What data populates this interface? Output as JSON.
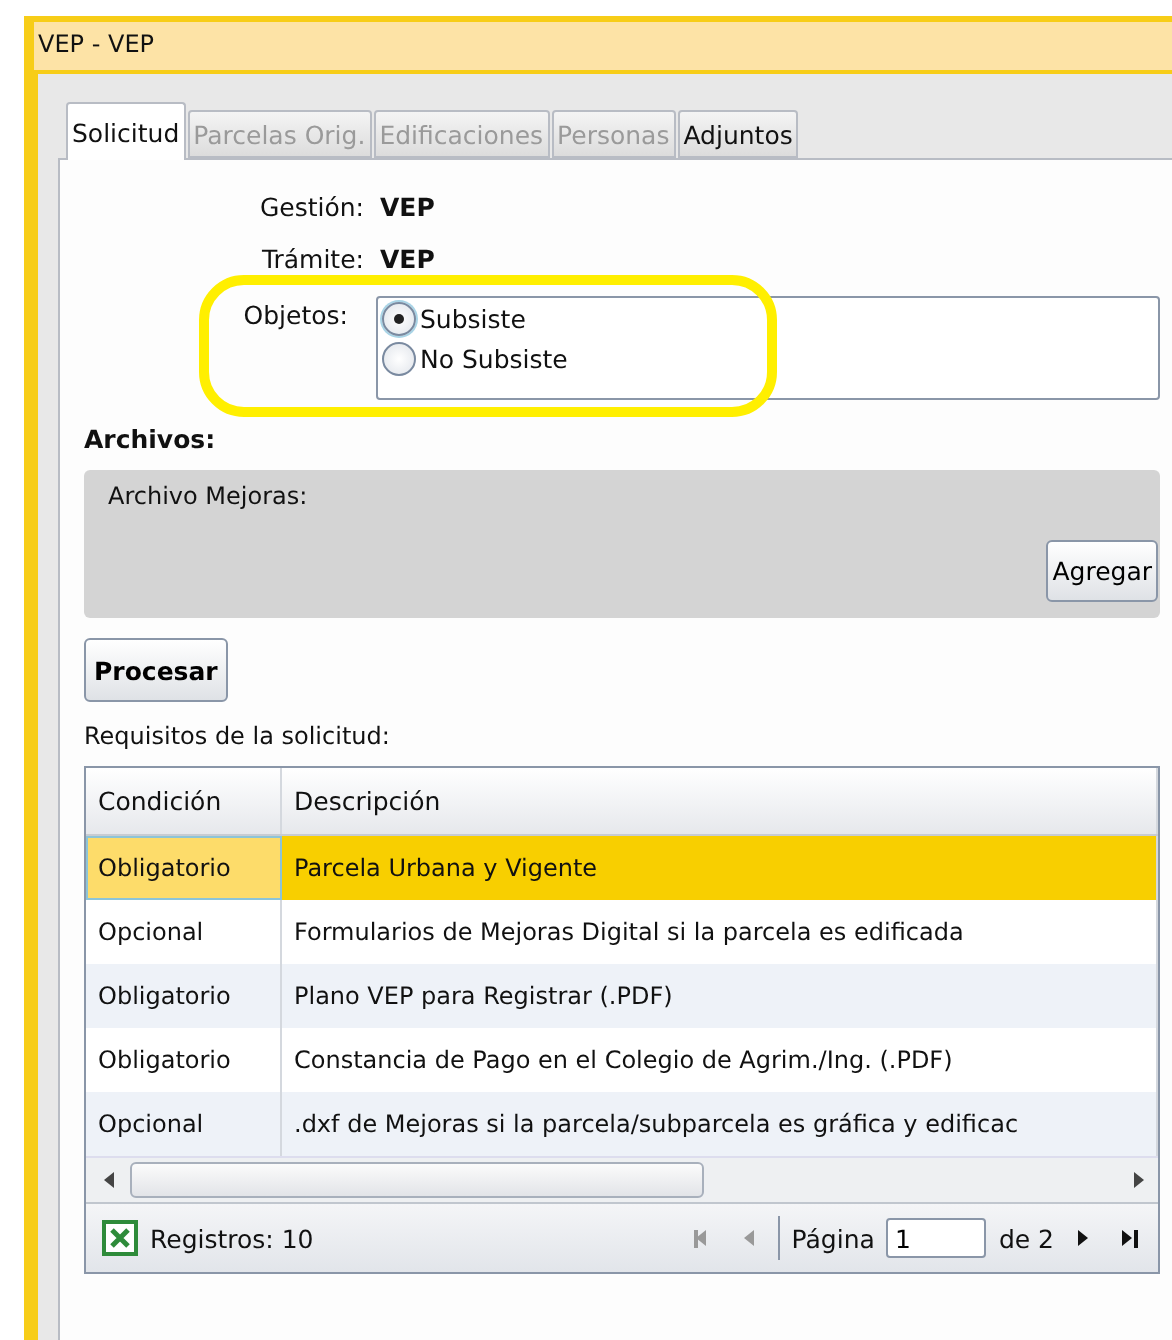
{
  "window": {
    "title": "VEP  -  VEP"
  },
  "tabs": [
    {
      "label": "Solicitud",
      "selected": true,
      "disabled": false
    },
    {
      "label": "Parcelas Orig.",
      "selected": false,
      "disabled": true
    },
    {
      "label": "Edificaciones",
      "selected": false,
      "disabled": true
    },
    {
      "label": "Personas",
      "selected": false,
      "disabled": true
    },
    {
      "label": "Adjuntos",
      "selected": false,
      "disabled": false
    }
  ],
  "fields": [
    {
      "label": "Gestión:",
      "value": "VEP"
    },
    {
      "label": "Trámite:",
      "value": "VEP"
    }
  ],
  "objetos": {
    "label": "Objetos:",
    "options": [
      {
        "label": "Subsiste",
        "selected": true
      },
      {
        "label": "No Subsiste",
        "selected": false
      }
    ]
  },
  "archivos": {
    "title": "Archivos:",
    "panel_label": "Archivo Mejoras:",
    "add_button": "Agregar"
  },
  "process_button": "Procesar",
  "requirements_label": "Requisitos de la solicitud:",
  "table": {
    "columns": [
      "Condición",
      "Descripción"
    ],
    "rows": [
      {
        "cells": [
          "Obligatorio",
          "Parcela Urbana y Vigente"
        ],
        "selected": true
      },
      {
        "cells": [
          "Opcional",
          "Formularios de Mejoras Digital si la parcela es edificada"
        ],
        "selected": false
      },
      {
        "cells": [
          "Obligatorio",
          "Plano VEP para Registrar (.PDF)"
        ],
        "selected": false
      },
      {
        "cells": [
          "Obligatorio",
          "Constancia de Pago en el Colegio de Agrim./Ing. (.PDF)"
        ],
        "selected": false
      },
      {
        "cells": [
          "Opcional",
          ".dxf de Mejoras si la parcela/subparcela es gráfica y edificac"
        ],
        "selected": false
      }
    ],
    "footer": {
      "records": "Registros: 10",
      "page_label": "Página",
      "page": "1",
      "page_total": "de 2"
    }
  }
}
